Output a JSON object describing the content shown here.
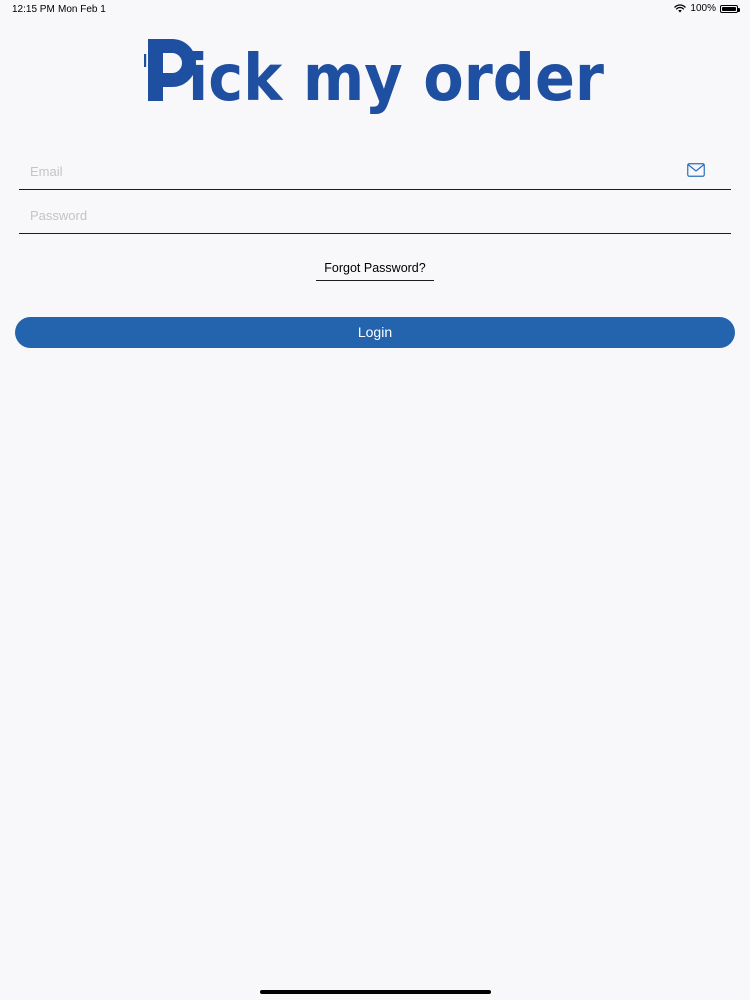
{
  "status_bar": {
    "time": "12:15 PM",
    "date": "Mon Feb 1",
    "battery": "100%",
    "battery_level": 1.0
  },
  "logo": {
    "text": "Pick my order",
    "color": "#1f4fa0"
  },
  "email_field": {
    "placeholder": "Email",
    "value": "",
    "icon": "mail-icon"
  },
  "password_field": {
    "placeholder": "Password",
    "value": ""
  },
  "forgot_password": {
    "label": "Forgot Password?"
  },
  "login_button": {
    "label": "Login",
    "color": "#2463ae"
  }
}
